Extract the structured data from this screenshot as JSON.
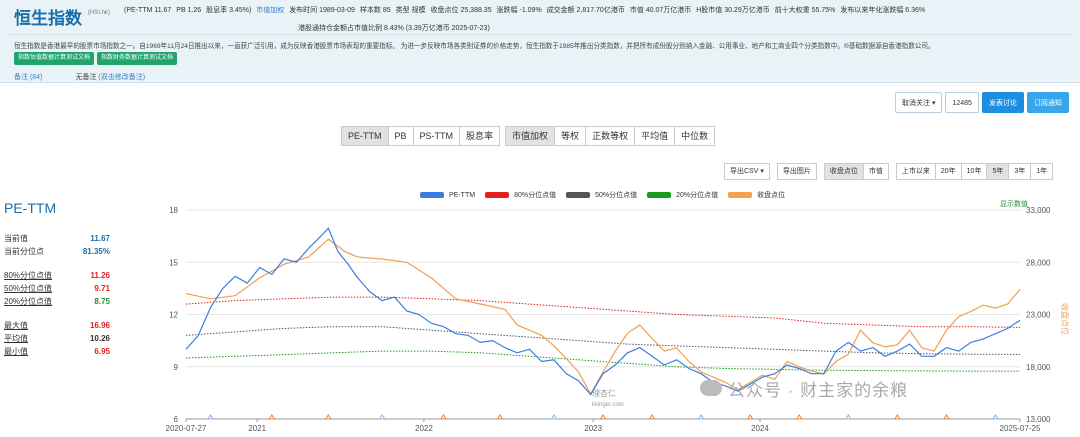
{
  "header": {
    "title": "恒生指数",
    "code": "(HSI.hk)",
    "stats": [
      "(PE-TTM 11.67",
      "PB 1.26",
      "股息率 3.45%)",
      "市值加权",
      "发布时间 1989-03-09",
      "样本数 85",
      "类型 规模",
      "收盘点位 25,388.35",
      "涨跌幅 -1.09%",
      "成交金额 2,817.70亿港币",
      "市值 40.07万亿港币",
      "H股市值 30.29万亿港币",
      "前十大权重 55.75%",
      "发布以来年化涨跌幅 6.36%"
    ],
    "stats2": "港股通持仓金额占市值比例 8.43% (3.39万亿港币   2025-07-23)",
    "description": "恒生指数是香港最早的股票市场指数之一。自1969年11月24日推出以来，一直获广泛引用，成为反映香港股票市场表现的重要指标。 为进一步反映市场各类别证券的价格走势，恒生指数于1985年推出分类指数，并把所有成份股分别纳入金融、公用事业、地产和工商业四个分类指数中。®基础数据源自香港指数公司。",
    "pill1": "指数估值数据计算测试文档",
    "pill2": "指数财务数据计算测试文档",
    "note_label": "备注 (84)",
    "no_note": "无备注",
    "no_note_link": "(双击修改备注)"
  },
  "follow": {
    "cancel": "取消关注 ▾",
    "count": "12485",
    "discuss": "发表讨论",
    "subscribe": "订阅通知"
  },
  "metric_tabs": [
    "PE-TTM",
    "PB",
    "PS-TTM",
    "股息率"
  ],
  "weight_tabs": [
    "市值加权",
    "等权",
    "正数等权",
    "平均值",
    "中位数"
  ],
  "tools": {
    "csv": "导出CSV ▾",
    "img": "导出图片",
    "view": [
      "收盘点位",
      "市值"
    ],
    "range": [
      "上市以来",
      "20年",
      "10年",
      "5年",
      "3年",
      "1年"
    ]
  },
  "sidebar": {
    "title": "PE-TTM",
    "rows": [
      {
        "label": "当前值",
        "value": "11.67",
        "color": "#1a6fa8"
      },
      {
        "label": "当前分位点",
        "value": "81.35%",
        "color": "#1a6fa8"
      },
      {
        "label": "80%分位点值",
        "value": "11.26",
        "color": "#d22"
      },
      {
        "label": "50%分位点值",
        "value": "9.71",
        "color": "#d22"
      },
      {
        "label": "20%分位点值",
        "value": "8.75",
        "color": "#2a8a3a"
      },
      {
        "label": "最大值",
        "value": "16.96",
        "color": "#d22"
      },
      {
        "label": "平均值",
        "value": "10.26",
        "color": "#333"
      },
      {
        "label": "最小值",
        "value": "6.95",
        "color": "#d22"
      }
    ]
  },
  "watermark": "公众号 · 财主家的余粮",
  "logo_text": "理杏仁",
  "logo_sub": "lixinger.com",
  "chart_data": {
    "type": "line",
    "show_data_label": "显示数值",
    "y_left": {
      "min": 6,
      "max": 18,
      "ticks": [
        6,
        9,
        12,
        15,
        18
      ]
    },
    "y_right": {
      "label": "收盘点位",
      "min": 13000,
      "max": 33000,
      "ticks": [
        "13,000",
        "18,000",
        "23,000",
        "28,000",
        "33,000"
      ]
    },
    "x_labels": [
      "2020-07-27",
      "2021",
      "2022",
      "2023",
      "2024",
      "2025-07-25"
    ],
    "legend": [
      {
        "name": "PE-TTM",
        "color": "#3a7fe0"
      },
      {
        "name": "80%分位点值",
        "color": "#e02020"
      },
      {
        "name": "50%分位点值",
        "color": "#555555"
      },
      {
        "name": "20%分位点值",
        "color": "#1a9a1a"
      },
      {
        "name": "收盘点位",
        "color": "#f0a050"
      }
    ],
    "pe_ttm": [
      [
        0,
        10.0
      ],
      [
        5,
        10.8
      ],
      [
        10,
        12.4
      ],
      [
        15,
        13.5
      ],
      [
        20,
        14.2
      ],
      [
        25,
        13.8
      ],
      [
        30,
        14.7
      ],
      [
        35,
        14.3
      ],
      [
        40,
        15.2
      ],
      [
        45,
        15.0
      ],
      [
        50,
        15.8
      ],
      [
        55,
        16.5
      ],
      [
        58,
        16.96
      ],
      [
        62,
        15.6
      ],
      [
        66,
        14.9
      ],
      [
        70,
        14.1
      ],
      [
        75,
        13.3
      ],
      [
        80,
        12.8
      ],
      [
        85,
        13.0
      ],
      [
        90,
        12.2
      ],
      [
        95,
        12.0
      ],
      [
        100,
        11.5
      ],
      [
        105,
        11.3
      ],
      [
        110,
        10.9
      ],
      [
        115,
        10.8
      ],
      [
        120,
        10.4
      ],
      [
        125,
        10.5
      ],
      [
        130,
        10.1
      ],
      [
        135,
        9.8
      ],
      [
        140,
        10.0
      ],
      [
        145,
        9.3
      ],
      [
        150,
        9.4
      ],
      [
        155,
        8.6
      ],
      [
        160,
        8.2
      ],
      [
        165,
        7.4
      ],
      [
        170,
        8.6
      ],
      [
        175,
        9.1
      ],
      [
        180,
        9.8
      ],
      [
        185,
        10.1
      ],
      [
        190,
        9.6
      ],
      [
        195,
        9.1
      ],
      [
        200,
        9.4
      ],
      [
        205,
        8.9
      ],
      [
        210,
        8.6
      ],
      [
        215,
        8.1
      ],
      [
        220,
        7.9
      ],
      [
        225,
        7.6
      ],
      [
        230,
        8.0
      ],
      [
        235,
        8.4
      ],
      [
        240,
        8.6
      ],
      [
        245,
        9.1
      ],
      [
        250,
        8.9
      ],
      [
        255,
        8.6
      ],
      [
        260,
        8.6
      ],
      [
        265,
        9.9
      ],
      [
        270,
        10.4
      ],
      [
        275,
        9.9
      ],
      [
        280,
        10.1
      ],
      [
        285,
        9.6
      ],
      [
        290,
        9.9
      ],
      [
        295,
        10.3
      ],
      [
        300,
        9.6
      ],
      [
        305,
        9.6
      ],
      [
        310,
        10.1
      ],
      [
        315,
        9.9
      ],
      [
        320,
        10.4
      ],
      [
        325,
        10.6
      ],
      [
        330,
        10.9
      ],
      [
        335,
        11.2
      ],
      [
        340,
        11.67
      ]
    ],
    "p80": [
      [
        0,
        12.6
      ],
      [
        20,
        12.8
      ],
      [
        40,
        12.9
      ],
      [
        60,
        13.0
      ],
      [
        80,
        13.0
      ],
      [
        100,
        12.9
      ],
      [
        120,
        12.8
      ],
      [
        140,
        12.6
      ],
      [
        160,
        12.4
      ],
      [
        180,
        12.2
      ],
      [
        200,
        12.0
      ],
      [
        220,
        11.9
      ],
      [
        240,
        11.8
      ],
      [
        260,
        11.5
      ],
      [
        280,
        11.4
      ],
      [
        300,
        11.3
      ],
      [
        320,
        11.3
      ],
      [
        340,
        11.26
      ]
    ],
    "p50": [
      [
        0,
        10.8
      ],
      [
        20,
        11.0
      ],
      [
        40,
        11.2
      ],
      [
        60,
        11.3
      ],
      [
        80,
        11.3
      ],
      [
        100,
        11.1
      ],
      [
        120,
        10.9
      ],
      [
        140,
        10.7
      ],
      [
        160,
        10.5
      ],
      [
        180,
        10.3
      ],
      [
        200,
        10.2
      ],
      [
        220,
        10.1
      ],
      [
        240,
        10.0
      ],
      [
        260,
        9.9
      ],
      [
        280,
        9.8
      ],
      [
        300,
        9.75
      ],
      [
        320,
        9.72
      ],
      [
        340,
        9.71
      ]
    ],
    "p20": [
      [
        0,
        9.5
      ],
      [
        20,
        9.6
      ],
      [
        40,
        9.7
      ],
      [
        60,
        9.8
      ],
      [
        80,
        9.9
      ],
      [
        100,
        9.9
      ],
      [
        120,
        9.8
      ],
      [
        140,
        9.6
      ],
      [
        160,
        9.4
      ],
      [
        180,
        9.2
      ],
      [
        200,
        9.0
      ],
      [
        220,
        8.9
      ],
      [
        240,
        8.85
      ],
      [
        260,
        8.8
      ],
      [
        280,
        8.78
      ],
      [
        300,
        8.76
      ],
      [
        320,
        8.75
      ],
      [
        340,
        8.75
      ]
    ],
    "close": [
      [
        0,
        25000
      ],
      [
        10,
        24500
      ],
      [
        20,
        24800
      ],
      [
        30,
        26500
      ],
      [
        40,
        27800
      ],
      [
        50,
        28500
      ],
      [
        58,
        30200
      ],
      [
        65,
        29000
      ],
      [
        70,
        28500
      ],
      [
        80,
        28300
      ],
      [
        90,
        28000
      ],
      [
        100,
        26500
      ],
      [
        110,
        24500
      ],
      [
        120,
        24000
      ],
      [
        130,
        23500
      ],
      [
        135,
        22000
      ],
      [
        140,
        21500
      ],
      [
        145,
        21000
      ],
      [
        150,
        20000
      ],
      [
        155,
        18800
      ],
      [
        160,
        17500
      ],
      [
        165,
        15400
      ],
      [
        170,
        17500
      ],
      [
        175,
        19500
      ],
      [
        180,
        21200
      ],
      [
        185,
        22000
      ],
      [
        190,
        20700
      ],
      [
        195,
        19500
      ],
      [
        200,
        19800
      ],
      [
        205,
        18500
      ],
      [
        210,
        17500
      ],
      [
        215,
        17000
      ],
      [
        220,
        16500
      ],
      [
        225,
        15800
      ],
      [
        230,
        16500
      ],
      [
        235,
        17200
      ],
      [
        240,
        16800
      ],
      [
        245,
        18500
      ],
      [
        250,
        18000
      ],
      [
        255,
        17600
      ],
      [
        260,
        17300
      ],
      [
        265,
        18500
      ],
      [
        270,
        19200
      ],
      [
        275,
        21500
      ],
      [
        280,
        20300
      ],
      [
        285,
        19900
      ],
      [
        290,
        20100
      ],
      [
        295,
        21500
      ],
      [
        300,
        19800
      ],
      [
        305,
        19500
      ],
      [
        310,
        21500
      ],
      [
        315,
        22800
      ],
      [
        320,
        23300
      ],
      [
        325,
        23900
      ],
      [
        330,
        23600
      ],
      [
        335,
        24000
      ],
      [
        340,
        25400
      ]
    ]
  }
}
